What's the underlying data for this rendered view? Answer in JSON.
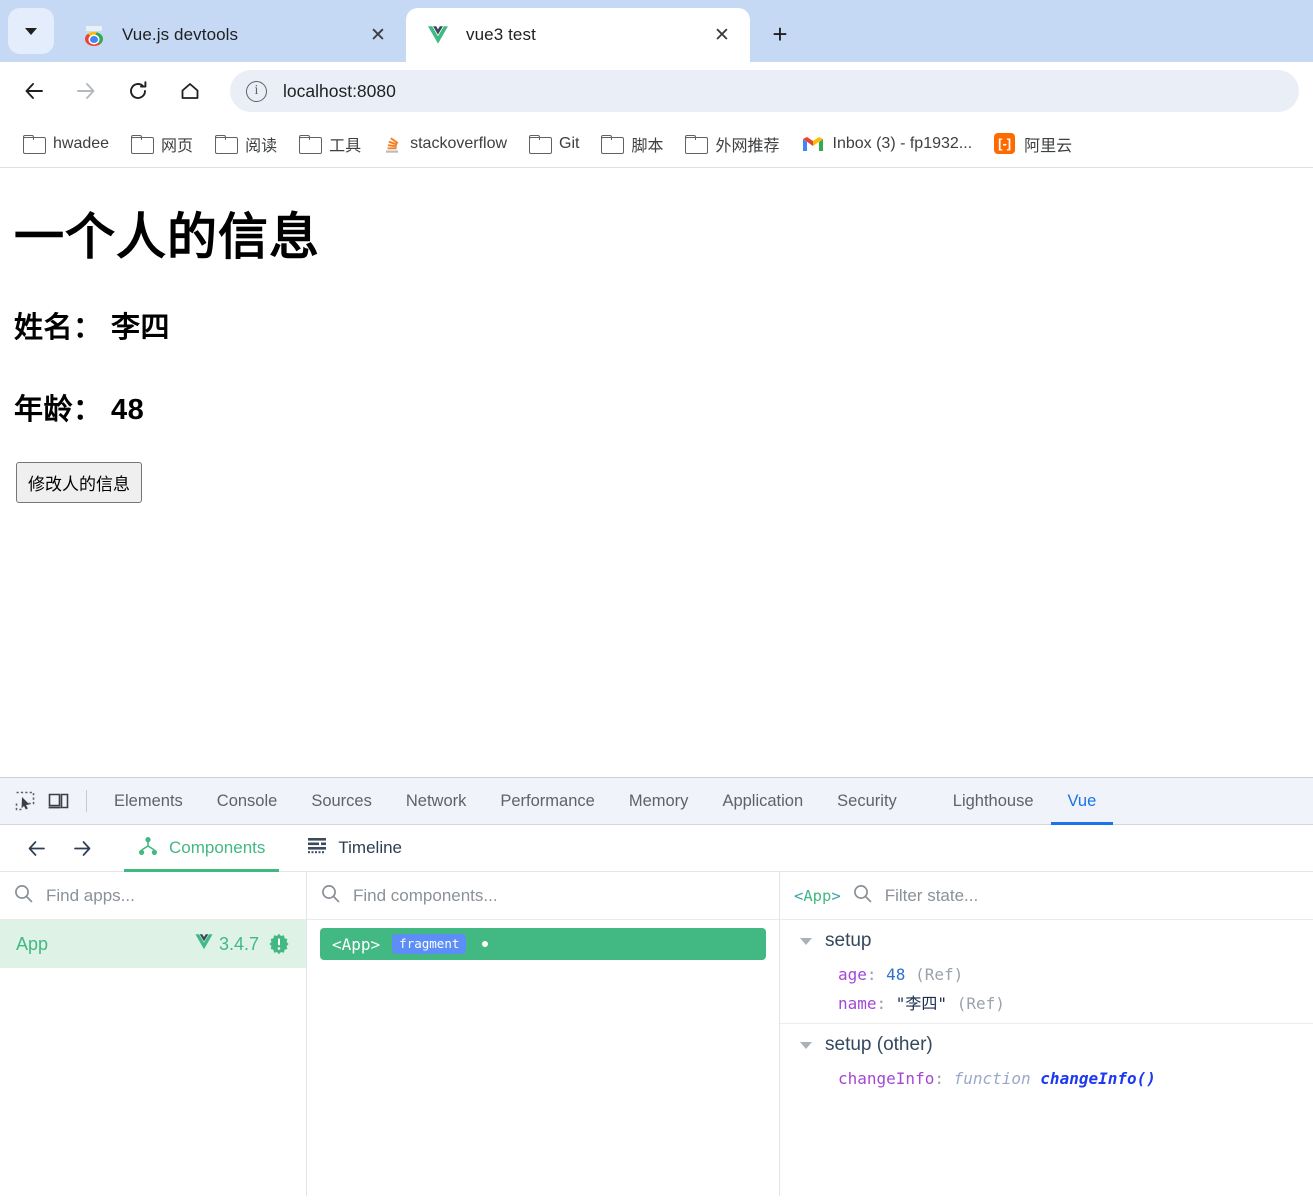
{
  "browser": {
    "tab_list_button": "tab-search",
    "tabs": [
      {
        "title": "Vue.js devtools",
        "favicon": "chrome-icon",
        "active": false,
        "close_label": "✕"
      },
      {
        "title": "vue3 test",
        "favicon": "vue-icon",
        "active": true,
        "close_label": "✕"
      }
    ],
    "new_tab_label": "+",
    "nav": {
      "back": "←",
      "forward": "→",
      "reload": "↻",
      "home": "⌂"
    },
    "omnibox": {
      "site_info_glyph": "i",
      "url": "localhost:8080"
    },
    "bookmarks": [
      {
        "label": "hwadee",
        "icon": "folder-icon"
      },
      {
        "label": "网页",
        "icon": "folder-icon"
      },
      {
        "label": "阅读",
        "icon": "folder-icon"
      },
      {
        "label": "工具",
        "icon": "folder-icon"
      },
      {
        "label": "stackoverflow",
        "icon": "stackoverflow-icon"
      },
      {
        "label": "Git",
        "icon": "folder-icon"
      },
      {
        "label": "脚本",
        "icon": "folder-icon"
      },
      {
        "label": "外网推荐",
        "icon": "folder-icon"
      },
      {
        "label": "Inbox (3) - fp1932...",
        "icon": "gmail-icon"
      },
      {
        "label": "阿里云",
        "icon": "aliyun-icon"
      }
    ]
  },
  "page": {
    "heading": "一个人的信息",
    "name_line": "姓名： 李四",
    "age_line": "年龄： 48",
    "button_label": "修改人的信息"
  },
  "devtools": {
    "toolbar_icons": [
      "inspect-element-icon",
      "device-toolbar-icon"
    ],
    "tabs": [
      {
        "label": "Elements",
        "selected": false
      },
      {
        "label": "Console",
        "selected": false
      },
      {
        "label": "Sources",
        "selected": false
      },
      {
        "label": "Network",
        "selected": false
      },
      {
        "label": "Performance",
        "selected": false
      },
      {
        "label": "Memory",
        "selected": false
      },
      {
        "label": "Application",
        "selected": false
      },
      {
        "label": "Security",
        "selected": false
      },
      {
        "label": "Lighthouse",
        "selected": false
      },
      {
        "label": "Vue",
        "selected": true
      }
    ],
    "accent_selected": "#1a73e8"
  },
  "vue_devtools": {
    "accent": "#42b883",
    "nav": {
      "back": "←",
      "forward": "→"
    },
    "tabs": [
      {
        "label": "Components",
        "icon": "components-tree-icon",
        "selected": true
      },
      {
        "label": "Timeline",
        "icon": "timeline-icon",
        "selected": false
      }
    ],
    "apps_panel": {
      "search_placeholder": "Find apps...",
      "search_icon": "search-icon",
      "selected_app": {
        "name": "App",
        "version": "3.4.7",
        "logo": "vue-logo-icon",
        "badge": "warning-badge-icon"
      }
    },
    "components_panel": {
      "search_placeholder": "Find components...",
      "search_icon": "search-icon",
      "tree": [
        {
          "name": "<App>",
          "badge": "fragment",
          "selected": true,
          "has_dot": true
        }
      ]
    },
    "state_panel": {
      "breadcrumb_open": "<",
      "breadcrumb_name": "App",
      "breadcrumb_close": ">",
      "search_icon": "search-icon",
      "filter_placeholder": "Filter state...",
      "groups": [
        {
          "title": "setup",
          "expanded": true,
          "entries": [
            {
              "key": "age",
              "sep": ": ",
              "value": "48",
              "value_kind": "number",
              "suffix": " (Ref)"
            },
            {
              "key": "name",
              "sep": ": ",
              "value": "\"李四\"",
              "value_kind": "string",
              "suffix": " (Ref)"
            }
          ]
        },
        {
          "title": "setup (other)",
          "expanded": true,
          "entries": [
            {
              "key": "changeInfo",
              "sep": ": ",
              "value_kw": "function ",
              "value_fn": "changeInfo()",
              "value_kind": "function"
            }
          ]
        }
      ]
    }
  }
}
